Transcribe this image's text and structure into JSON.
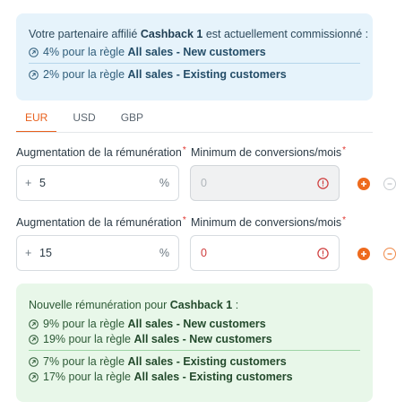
{
  "info": {
    "intro_prefix": "Votre partenaire affilié ",
    "affiliate": "Cashback 1",
    "intro_suffix": " est actuellement commissionné :",
    "rules": [
      {
        "percent": "4% pour la règle ",
        "rule": "All sales - New customers"
      },
      {
        "percent": "2% pour la règle ",
        "rule": "All sales - Existing customers"
      }
    ]
  },
  "tabs": [
    {
      "label": "EUR",
      "active": true
    },
    {
      "label": "USD",
      "active": false
    },
    {
      "label": "GBP",
      "active": false
    }
  ],
  "rows": [
    {
      "increase_label": "Augmentation de la rémunération",
      "min_label": "Minimum de conversions/mois",
      "required": "*",
      "plus": "+",
      "increase_value": "5",
      "unit": "%",
      "min_value": "0",
      "min_disabled": true
    },
    {
      "increase_label": "Augmentation de la rémunération",
      "min_label": "Minimum de conversions/mois",
      "required": "*",
      "plus": "+",
      "increase_value": "15",
      "unit": "%",
      "min_value": "0",
      "min_disabled": false
    }
  ],
  "result": {
    "intro_prefix": "Nouvelle rémunération pour ",
    "affiliate": "Cashback 1",
    "intro_suffix": " :",
    "new_customers": [
      {
        "percent": "9% pour la règle ",
        "rule": "All sales - New customers"
      },
      {
        "percent": "19% pour la règle ",
        "rule": "All sales - New customers"
      }
    ],
    "existing_customers": [
      {
        "percent": "7% pour la règle ",
        "rule": "All sales - Existing customers"
      },
      {
        "percent": "17% pour la règle ",
        "rule": "All sales - Existing customers"
      }
    ]
  },
  "colors": {
    "accent": "#e8601c",
    "info_bg": "#e6f3fb",
    "result_bg": "#e8f7e9",
    "error": "#cf3b3b"
  },
  "icons": {
    "rule": "arrow-up-right-circle-icon",
    "warning": "exclamation-circle-icon",
    "add": "plus-circle-icon",
    "remove": "minus-circle-icon"
  }
}
